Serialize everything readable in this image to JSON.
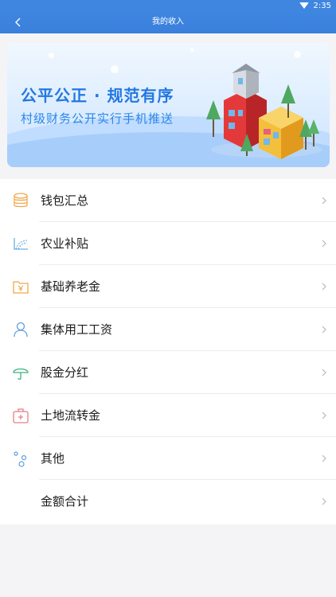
{
  "status_bar": {
    "time": "2:35",
    "wifi_icon": "wifi-icon"
  },
  "header": {
    "title": "我的收入",
    "back_icon": "back-arrow-icon"
  },
  "banner": {
    "title": "公平公正 · 规范有序",
    "subtitle": "村级财务公开实行手机推送"
  },
  "menu": {
    "items": [
      {
        "label": "钱包汇总",
        "icon": "coin-stack-icon",
        "icon_color": "#f0a84b"
      },
      {
        "label": "农业补贴",
        "icon": "field-icon",
        "icon_color": "#6aafdf"
      },
      {
        "label": "基础养老金",
        "icon": "yuan-folder-icon",
        "icon_color": "#f0a84b"
      },
      {
        "label": "集体用工工资",
        "icon": "person-icon",
        "icon_color": "#5a9edf"
      },
      {
        "label": "股金分红",
        "icon": "umbrella-icon",
        "icon_color": "#3db383"
      },
      {
        "label": "土地流转金",
        "icon": "medical-kit-icon",
        "icon_color": "#e87d88"
      },
      {
        "label": "其他",
        "icon": "bubbles-icon",
        "icon_color": "#5a9edf"
      },
      {
        "label": "金额合计",
        "icon": "",
        "icon_color": ""
      }
    ]
  },
  "colors": {
    "header_blue": "#3f86e0",
    "banner_text": "#2478e1"
  }
}
